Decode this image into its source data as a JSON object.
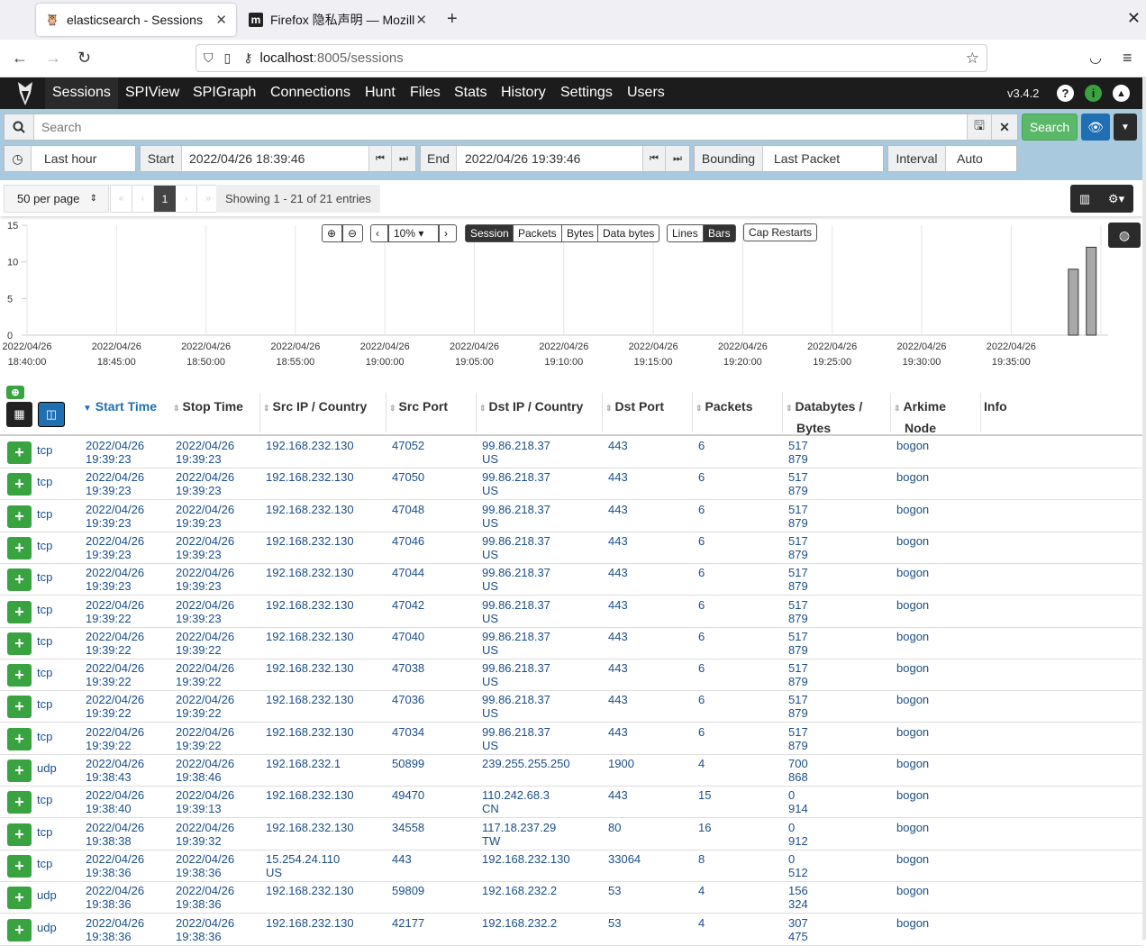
{
  "browser": {
    "tabs": [
      {
        "title": "elasticsearch - Sessions",
        "active": true
      },
      {
        "title": "Firefox 隐私声明 — Mozill",
        "active": false
      }
    ],
    "url_host": "localhost",
    "url_rest": ":8005/sessions"
  },
  "nav": {
    "items": [
      "Sessions",
      "SPIView",
      "SPIGraph",
      "Connections",
      "Hunt",
      "Files",
      "Stats",
      "History",
      "Settings",
      "Users"
    ],
    "version": "v3.4.2"
  },
  "search": {
    "placeholder": "Search",
    "search_button": "Search",
    "time_range": "Last hour",
    "start_label": "Start",
    "start_value": "2022/04/26 18:39:46",
    "end_label": "End",
    "end_value": "2022/04/26 19:39:46",
    "bounding_label": "Bounding",
    "bounding_value": "Last Packet",
    "interval_label": "Interval",
    "interval_value": "Auto"
  },
  "paging": {
    "per_page": "50 per page",
    "current_page": "1",
    "showing": "Showing 1 - 21 of 21 entries"
  },
  "graph_controls": {
    "zoom_level": "10%",
    "metric_buttons": [
      "Session",
      "Packets",
      "Bytes",
      "Data bytes"
    ],
    "style_buttons": [
      "Lines",
      "Bars"
    ],
    "cap_restarts": "Cap Restarts"
  },
  "chart_data": {
    "type": "bar",
    "y_ticks": [
      "15",
      "10",
      "5",
      "0"
    ],
    "ylim": [
      0,
      15
    ],
    "x_ticks": [
      [
        "2022/04/26",
        "18:40:00"
      ],
      [
        "2022/04/26",
        "18:45:00"
      ],
      [
        "2022/04/26",
        "18:50:00"
      ],
      [
        "2022/04/26",
        "18:55:00"
      ],
      [
        "2022/04/26",
        "19:00:00"
      ],
      [
        "2022/04/26",
        "19:05:00"
      ],
      [
        "2022/04/26",
        "19:10:00"
      ],
      [
        "2022/04/26",
        "19:15:00"
      ],
      [
        "2022/04/26",
        "19:20:00"
      ],
      [
        "2022/04/26",
        "19:25:00"
      ],
      [
        "2022/04/26",
        "19:30:00"
      ],
      [
        "2022/04/26",
        "19:35:00"
      ]
    ],
    "bars": [
      {
        "x": "2022/04/26 19:38:00",
        "value": 9
      },
      {
        "x": "2022/04/26 19:39:00",
        "value": 12
      }
    ]
  },
  "table": {
    "columns": [
      "Start Time",
      "Stop Time",
      "Src IP / Country",
      "Src Port",
      "Dst IP / Country",
      "Dst Port",
      "Packets",
      "Databytes /",
      "Bytes",
      "Arkime",
      "Node",
      "Info"
    ],
    "rows": [
      {
        "proto": "tcp",
        "start": [
          "2022/04/26",
          "19:39:23"
        ],
        "stop": [
          "2022/04/26",
          "19:39:23"
        ],
        "src": [
          "192.168.232.130",
          ""
        ],
        "sport": "47052",
        "dst": [
          "99.86.218.37",
          "US"
        ],
        "dport": "443",
        "packets": "6",
        "bytes": [
          "517",
          "879"
        ],
        "node": "bogon"
      },
      {
        "proto": "tcp",
        "start": [
          "2022/04/26",
          "19:39:23"
        ],
        "stop": [
          "2022/04/26",
          "19:39:23"
        ],
        "src": [
          "192.168.232.130",
          ""
        ],
        "sport": "47050",
        "dst": [
          "99.86.218.37",
          "US"
        ],
        "dport": "443",
        "packets": "6",
        "bytes": [
          "517",
          "879"
        ],
        "node": "bogon"
      },
      {
        "proto": "tcp",
        "start": [
          "2022/04/26",
          "19:39:23"
        ],
        "stop": [
          "2022/04/26",
          "19:39:23"
        ],
        "src": [
          "192.168.232.130",
          ""
        ],
        "sport": "47048",
        "dst": [
          "99.86.218.37",
          "US"
        ],
        "dport": "443",
        "packets": "6",
        "bytes": [
          "517",
          "879"
        ],
        "node": "bogon"
      },
      {
        "proto": "tcp",
        "start": [
          "2022/04/26",
          "19:39:23"
        ],
        "stop": [
          "2022/04/26",
          "19:39:23"
        ],
        "src": [
          "192.168.232.130",
          ""
        ],
        "sport": "47046",
        "dst": [
          "99.86.218.37",
          "US"
        ],
        "dport": "443",
        "packets": "6",
        "bytes": [
          "517",
          "879"
        ],
        "node": "bogon"
      },
      {
        "proto": "tcp",
        "start": [
          "2022/04/26",
          "19:39:23"
        ],
        "stop": [
          "2022/04/26",
          "19:39:23"
        ],
        "src": [
          "192.168.232.130",
          ""
        ],
        "sport": "47044",
        "dst": [
          "99.86.218.37",
          "US"
        ],
        "dport": "443",
        "packets": "6",
        "bytes": [
          "517",
          "879"
        ],
        "node": "bogon"
      },
      {
        "proto": "tcp",
        "start": [
          "2022/04/26",
          "19:39:22"
        ],
        "stop": [
          "2022/04/26",
          "19:39:23"
        ],
        "src": [
          "192.168.232.130",
          ""
        ],
        "sport": "47042",
        "dst": [
          "99.86.218.37",
          "US"
        ],
        "dport": "443",
        "packets": "6",
        "bytes": [
          "517",
          "879"
        ],
        "node": "bogon"
      },
      {
        "proto": "tcp",
        "start": [
          "2022/04/26",
          "19:39:22"
        ],
        "stop": [
          "2022/04/26",
          "19:39:22"
        ],
        "src": [
          "192.168.232.130",
          ""
        ],
        "sport": "47040",
        "dst": [
          "99.86.218.37",
          "US"
        ],
        "dport": "443",
        "packets": "6",
        "bytes": [
          "517",
          "879"
        ],
        "node": "bogon"
      },
      {
        "proto": "tcp",
        "start": [
          "2022/04/26",
          "19:39:22"
        ],
        "stop": [
          "2022/04/26",
          "19:39:22"
        ],
        "src": [
          "192.168.232.130",
          ""
        ],
        "sport": "47038",
        "dst": [
          "99.86.218.37",
          "US"
        ],
        "dport": "443",
        "packets": "6",
        "bytes": [
          "517",
          "879"
        ],
        "node": "bogon"
      },
      {
        "proto": "tcp",
        "start": [
          "2022/04/26",
          "19:39:22"
        ],
        "stop": [
          "2022/04/26",
          "19:39:22"
        ],
        "src": [
          "192.168.232.130",
          ""
        ],
        "sport": "47036",
        "dst": [
          "99.86.218.37",
          "US"
        ],
        "dport": "443",
        "packets": "6",
        "bytes": [
          "517",
          "879"
        ],
        "node": "bogon"
      },
      {
        "proto": "tcp",
        "start": [
          "2022/04/26",
          "19:39:22"
        ],
        "stop": [
          "2022/04/26",
          "19:39:22"
        ],
        "src": [
          "192.168.232.130",
          ""
        ],
        "sport": "47034",
        "dst": [
          "99.86.218.37",
          "US"
        ],
        "dport": "443",
        "packets": "6",
        "bytes": [
          "517",
          "879"
        ],
        "node": "bogon"
      },
      {
        "proto": "udp",
        "start": [
          "2022/04/26",
          "19:38:43"
        ],
        "stop": [
          "2022/04/26",
          "19:38:46"
        ],
        "src": [
          "192.168.232.1",
          ""
        ],
        "sport": "50899",
        "dst": [
          "239.255.255.250",
          ""
        ],
        "dport": "1900",
        "packets": "4",
        "bytes": [
          "700",
          "868"
        ],
        "node": "bogon"
      },
      {
        "proto": "tcp",
        "start": [
          "2022/04/26",
          "19:38:40"
        ],
        "stop": [
          "2022/04/26",
          "19:39:13"
        ],
        "src": [
          "192.168.232.130",
          ""
        ],
        "sport": "49470",
        "dst": [
          "110.242.68.3",
          "CN"
        ],
        "dport": "443",
        "packets": "15",
        "bytes": [
          "0",
          "914"
        ],
        "node": "bogon"
      },
      {
        "proto": "tcp",
        "start": [
          "2022/04/26",
          "19:38:38"
        ],
        "stop": [
          "2022/04/26",
          "19:39:32"
        ],
        "src": [
          "192.168.232.130",
          ""
        ],
        "sport": "34558",
        "dst": [
          "117.18.237.29",
          "TW"
        ],
        "dport": "80",
        "packets": "16",
        "bytes": [
          "0",
          "912"
        ],
        "node": "bogon"
      },
      {
        "proto": "tcp",
        "start": [
          "2022/04/26",
          "19:38:36"
        ],
        "stop": [
          "2022/04/26",
          "19:38:36"
        ],
        "src": [
          "15.254.24.110",
          "US"
        ],
        "sport": "443",
        "dst": [
          "192.168.232.130",
          ""
        ],
        "dport": "33064",
        "packets": "8",
        "bytes": [
          "0",
          "512"
        ],
        "node": "bogon"
      },
      {
        "proto": "udp",
        "start": [
          "2022/04/26",
          "19:38:36"
        ],
        "stop": [
          "2022/04/26",
          "19:38:36"
        ],
        "src": [
          "192.168.232.130",
          ""
        ],
        "sport": "59809",
        "dst": [
          "192.168.232.2",
          ""
        ],
        "dport": "53",
        "packets": "4",
        "bytes": [
          "156",
          "324"
        ],
        "node": "bogon"
      },
      {
        "proto": "udp",
        "start": [
          "2022/04/26",
          "19:38:36"
        ],
        "stop": [
          "2022/04/26",
          "19:38:36"
        ],
        "src": [
          "192.168.232.130",
          ""
        ],
        "sport": "42177",
        "dst": [
          "192.168.232.2",
          ""
        ],
        "dport": "53",
        "packets": "4",
        "bytes": [
          "307",
          "475"
        ],
        "node": "bogon"
      }
    ]
  },
  "colors": {
    "nav_bg": "#1c1c1c",
    "search_bg": "#a9c9df",
    "accent_green": "#3aa341",
    "link": "#1a4e8a",
    "primary_blue": "#1f6fb2"
  }
}
